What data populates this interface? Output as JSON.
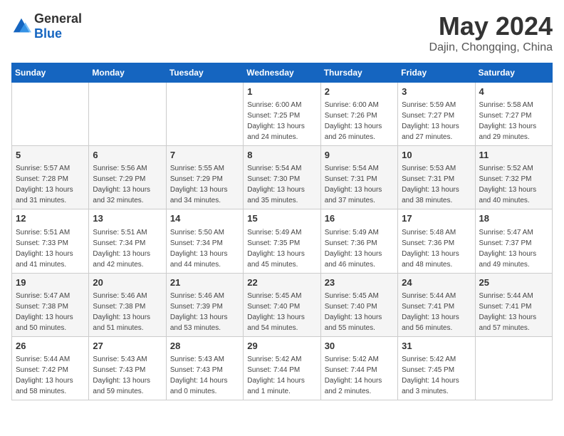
{
  "header": {
    "logo_general": "General",
    "logo_blue": "Blue",
    "month": "May 2024",
    "location": "Dajin, Chongqing, China"
  },
  "weekdays": [
    "Sunday",
    "Monday",
    "Tuesday",
    "Wednesday",
    "Thursday",
    "Friday",
    "Saturday"
  ],
  "weeks": [
    [
      {
        "day": "",
        "sunrise": "",
        "sunset": "",
        "daylight": ""
      },
      {
        "day": "",
        "sunrise": "",
        "sunset": "",
        "daylight": ""
      },
      {
        "day": "",
        "sunrise": "",
        "sunset": "",
        "daylight": ""
      },
      {
        "day": "1",
        "sunrise": "Sunrise: 6:00 AM",
        "sunset": "Sunset: 7:25 PM",
        "daylight": "Daylight: 13 hours and 24 minutes."
      },
      {
        "day": "2",
        "sunrise": "Sunrise: 6:00 AM",
        "sunset": "Sunset: 7:26 PM",
        "daylight": "Daylight: 13 hours and 26 minutes."
      },
      {
        "day": "3",
        "sunrise": "Sunrise: 5:59 AM",
        "sunset": "Sunset: 7:27 PM",
        "daylight": "Daylight: 13 hours and 27 minutes."
      },
      {
        "day": "4",
        "sunrise": "Sunrise: 5:58 AM",
        "sunset": "Sunset: 7:27 PM",
        "daylight": "Daylight: 13 hours and 29 minutes."
      }
    ],
    [
      {
        "day": "5",
        "sunrise": "Sunrise: 5:57 AM",
        "sunset": "Sunset: 7:28 PM",
        "daylight": "Daylight: 13 hours and 31 minutes."
      },
      {
        "day": "6",
        "sunrise": "Sunrise: 5:56 AM",
        "sunset": "Sunset: 7:29 PM",
        "daylight": "Daylight: 13 hours and 32 minutes."
      },
      {
        "day": "7",
        "sunrise": "Sunrise: 5:55 AM",
        "sunset": "Sunset: 7:29 PM",
        "daylight": "Daylight: 13 hours and 34 minutes."
      },
      {
        "day": "8",
        "sunrise": "Sunrise: 5:54 AM",
        "sunset": "Sunset: 7:30 PM",
        "daylight": "Daylight: 13 hours and 35 minutes."
      },
      {
        "day": "9",
        "sunrise": "Sunrise: 5:54 AM",
        "sunset": "Sunset: 7:31 PM",
        "daylight": "Daylight: 13 hours and 37 minutes."
      },
      {
        "day": "10",
        "sunrise": "Sunrise: 5:53 AM",
        "sunset": "Sunset: 7:31 PM",
        "daylight": "Daylight: 13 hours and 38 minutes."
      },
      {
        "day": "11",
        "sunrise": "Sunrise: 5:52 AM",
        "sunset": "Sunset: 7:32 PM",
        "daylight": "Daylight: 13 hours and 40 minutes."
      }
    ],
    [
      {
        "day": "12",
        "sunrise": "Sunrise: 5:51 AM",
        "sunset": "Sunset: 7:33 PM",
        "daylight": "Daylight: 13 hours and 41 minutes."
      },
      {
        "day": "13",
        "sunrise": "Sunrise: 5:51 AM",
        "sunset": "Sunset: 7:34 PM",
        "daylight": "Daylight: 13 hours and 42 minutes."
      },
      {
        "day": "14",
        "sunrise": "Sunrise: 5:50 AM",
        "sunset": "Sunset: 7:34 PM",
        "daylight": "Daylight: 13 hours and 44 minutes."
      },
      {
        "day": "15",
        "sunrise": "Sunrise: 5:49 AM",
        "sunset": "Sunset: 7:35 PM",
        "daylight": "Daylight: 13 hours and 45 minutes."
      },
      {
        "day": "16",
        "sunrise": "Sunrise: 5:49 AM",
        "sunset": "Sunset: 7:36 PM",
        "daylight": "Daylight: 13 hours and 46 minutes."
      },
      {
        "day": "17",
        "sunrise": "Sunrise: 5:48 AM",
        "sunset": "Sunset: 7:36 PM",
        "daylight": "Daylight: 13 hours and 48 minutes."
      },
      {
        "day": "18",
        "sunrise": "Sunrise: 5:47 AM",
        "sunset": "Sunset: 7:37 PM",
        "daylight": "Daylight: 13 hours and 49 minutes."
      }
    ],
    [
      {
        "day": "19",
        "sunrise": "Sunrise: 5:47 AM",
        "sunset": "Sunset: 7:38 PM",
        "daylight": "Daylight: 13 hours and 50 minutes."
      },
      {
        "day": "20",
        "sunrise": "Sunrise: 5:46 AM",
        "sunset": "Sunset: 7:38 PM",
        "daylight": "Daylight: 13 hours and 51 minutes."
      },
      {
        "day": "21",
        "sunrise": "Sunrise: 5:46 AM",
        "sunset": "Sunset: 7:39 PM",
        "daylight": "Daylight: 13 hours and 53 minutes."
      },
      {
        "day": "22",
        "sunrise": "Sunrise: 5:45 AM",
        "sunset": "Sunset: 7:40 PM",
        "daylight": "Daylight: 13 hours and 54 minutes."
      },
      {
        "day": "23",
        "sunrise": "Sunrise: 5:45 AM",
        "sunset": "Sunset: 7:40 PM",
        "daylight": "Daylight: 13 hours and 55 minutes."
      },
      {
        "day": "24",
        "sunrise": "Sunrise: 5:44 AM",
        "sunset": "Sunset: 7:41 PM",
        "daylight": "Daylight: 13 hours and 56 minutes."
      },
      {
        "day": "25",
        "sunrise": "Sunrise: 5:44 AM",
        "sunset": "Sunset: 7:41 PM",
        "daylight": "Daylight: 13 hours and 57 minutes."
      }
    ],
    [
      {
        "day": "26",
        "sunrise": "Sunrise: 5:44 AM",
        "sunset": "Sunset: 7:42 PM",
        "daylight": "Daylight: 13 hours and 58 minutes."
      },
      {
        "day": "27",
        "sunrise": "Sunrise: 5:43 AM",
        "sunset": "Sunset: 7:43 PM",
        "daylight": "Daylight: 13 hours and 59 minutes."
      },
      {
        "day": "28",
        "sunrise": "Sunrise: 5:43 AM",
        "sunset": "Sunset: 7:43 PM",
        "daylight": "Daylight: 14 hours and 0 minutes."
      },
      {
        "day": "29",
        "sunrise": "Sunrise: 5:42 AM",
        "sunset": "Sunset: 7:44 PM",
        "daylight": "Daylight: 14 hours and 1 minute."
      },
      {
        "day": "30",
        "sunrise": "Sunrise: 5:42 AM",
        "sunset": "Sunset: 7:44 PM",
        "daylight": "Daylight: 14 hours and 2 minutes."
      },
      {
        "day": "31",
        "sunrise": "Sunrise: 5:42 AM",
        "sunset": "Sunset: 7:45 PM",
        "daylight": "Daylight: 14 hours and 3 minutes."
      },
      {
        "day": "",
        "sunrise": "",
        "sunset": "",
        "daylight": ""
      }
    ]
  ]
}
